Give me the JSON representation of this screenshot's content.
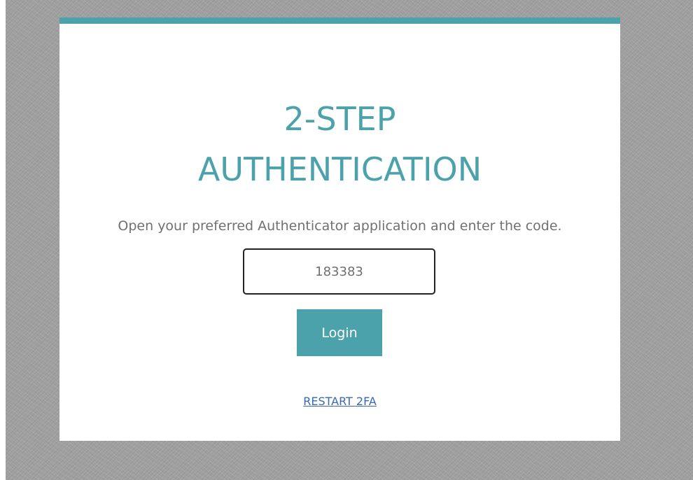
{
  "colors": {
    "accent": "#4ba2ab",
    "link": "#3a67b6",
    "text_muted": "#707070",
    "background": "#9e9e9e"
  },
  "auth": {
    "title_line1": "2-STEP",
    "title_line2": "AUTHENTICATION",
    "instructions": "Open your preferred Authenticator application and enter the code.",
    "code_value": "183383",
    "login_label": "Login",
    "restart_label": "RESTART 2FA"
  }
}
